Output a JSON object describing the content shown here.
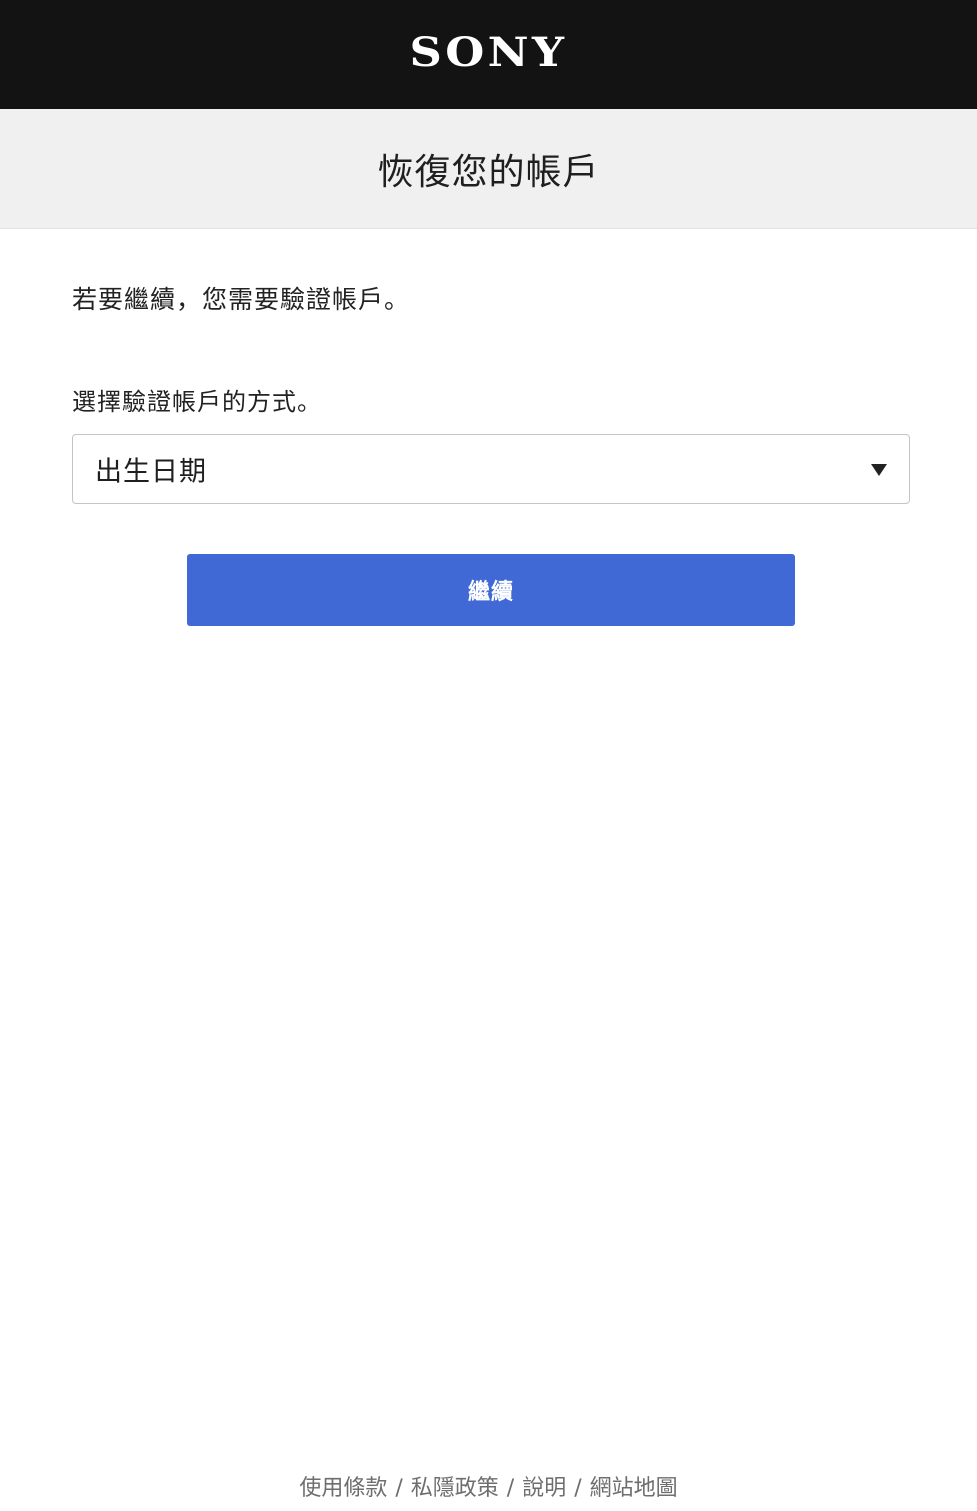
{
  "header": {
    "logo_text": "SONY",
    "background": "#131313"
  },
  "titlebar": {
    "title": "恢復您的帳戶"
  },
  "main": {
    "intro_text": "若要繼續，您需要驗證帳戶。",
    "method_label": "選擇驗證帳戶的方式。",
    "method_select": {
      "selected_value": "出生日期"
    },
    "continue_button": {
      "label": "繼續",
      "color": "#4069d6"
    }
  },
  "footer": {
    "links": [
      {
        "label": "使用條款"
      },
      {
        "label": "私隱政策"
      },
      {
        "label": "說明"
      },
      {
        "label": "網站地圖"
      }
    ],
    "separator": "/"
  }
}
